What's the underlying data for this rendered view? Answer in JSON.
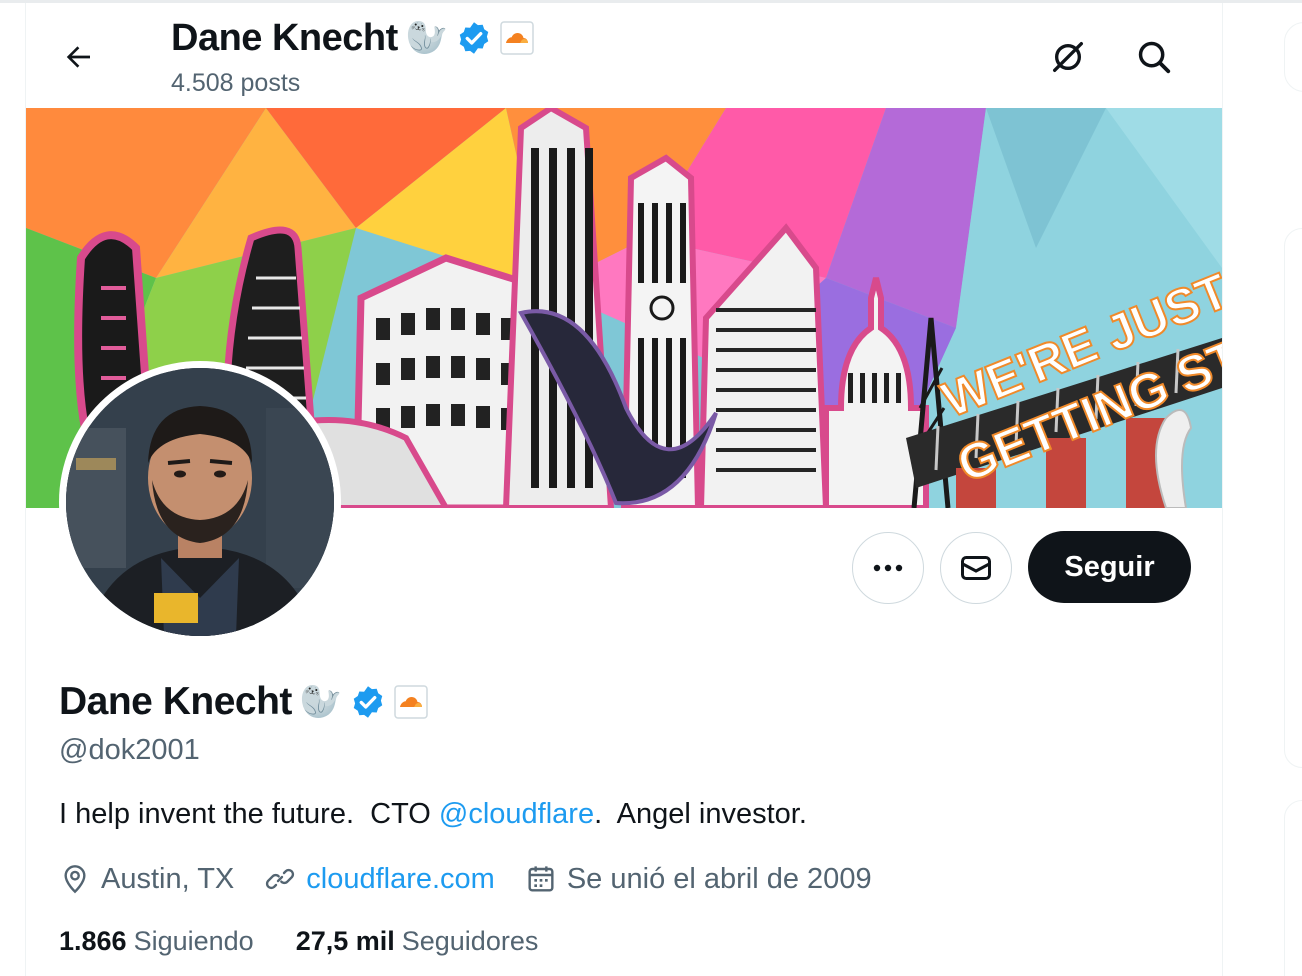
{
  "header": {
    "name": "Dane Knecht",
    "emoji": "🦭",
    "posts": "4.508 posts"
  },
  "profile": {
    "display_name": "Dane Knecht",
    "emoji": "🦭",
    "handle": "@dok2001",
    "bio_before": "I help invent the future.  CTO ",
    "bio_link": "@cloudflare",
    "bio_after": ".  Angel investor.",
    "location": "Austin, TX",
    "website": "cloudflare.com",
    "joined": "Se unió el abril de 2009"
  },
  "actions": {
    "follow_label": "Seguir"
  },
  "stats": {
    "following_count": "1.866",
    "following_label": "Siguiendo",
    "followers_count": "27,5 mil",
    "followers_label": "Seguidores"
  },
  "banner": {
    "text_line1": "WE'RE JUST",
    "text_line2": "GETTING STARTED"
  },
  "colors": {
    "verified": "#1d9bf0",
    "link": "#1d9bf0",
    "follow_button": "#0f1419",
    "cloudflare_orange": "#f48120"
  },
  "icons": {
    "back": "arrow-left-icon",
    "grok": "grok-icon",
    "search": "search-icon",
    "more": "more-icon",
    "message": "envelope-icon",
    "location": "location-pin-icon",
    "website": "link-icon",
    "joined": "calendar-icon",
    "verified": "verified-badge-icon",
    "affiliate": "cloudflare-logo-icon"
  }
}
